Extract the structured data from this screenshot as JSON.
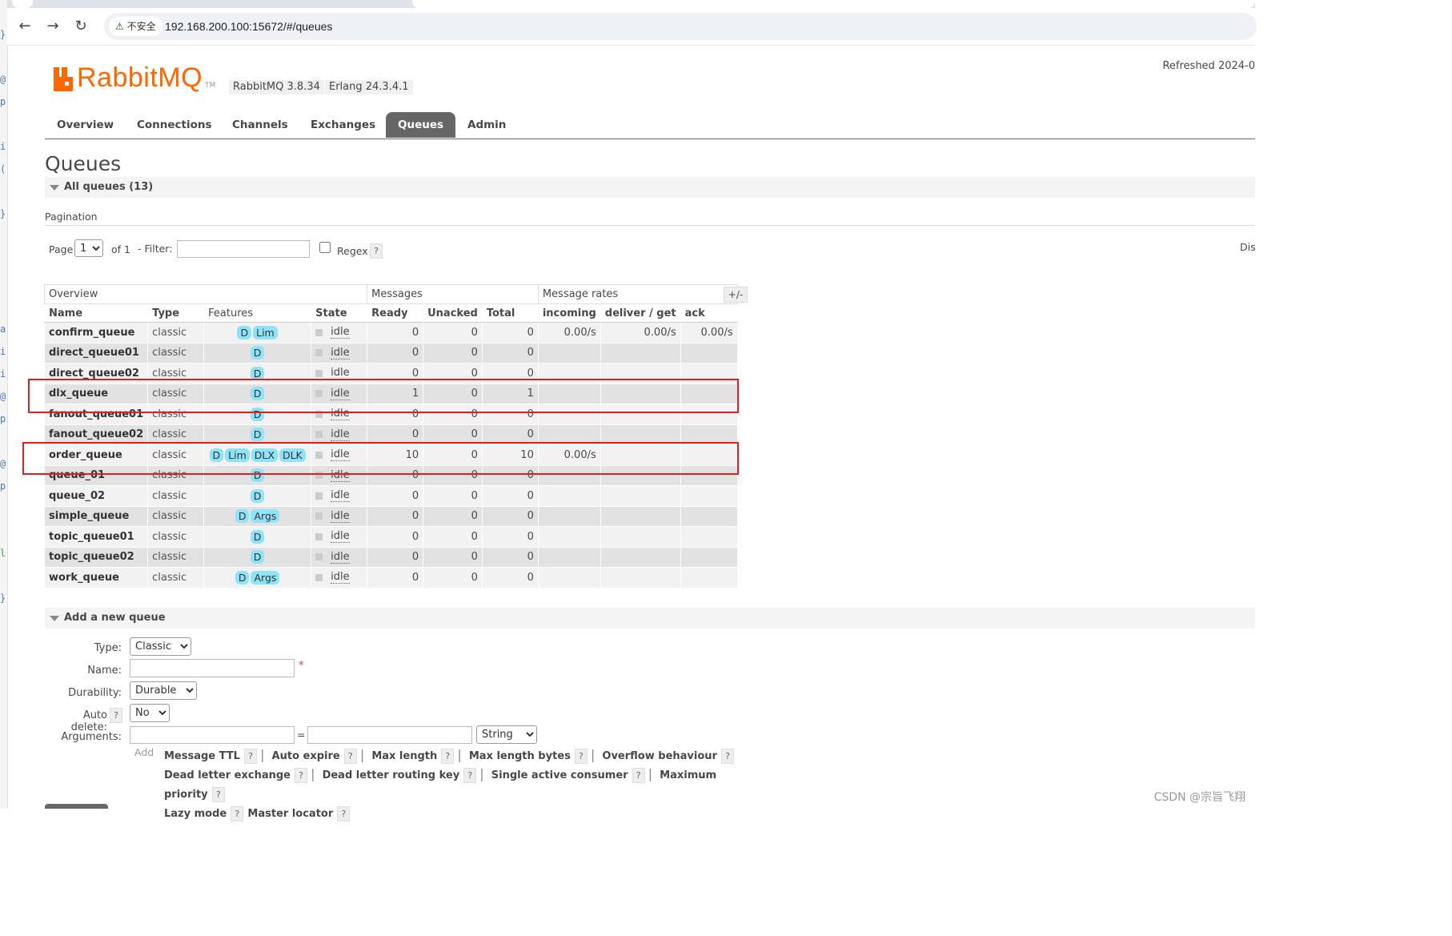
{
  "browser": {
    "security_label": "不安全",
    "url": "192.168.200.100:15672/#/queues"
  },
  "header": {
    "brand": "RabbitMQ",
    "tm": "TM",
    "rabbitmq_version": "RabbitMQ 3.8.34",
    "erlang_version": "Erlang 24.3.4.1",
    "refreshed": "Refreshed 2024-0"
  },
  "nav": {
    "tabs": [
      {
        "label": "Overview"
      },
      {
        "label": "Connections"
      },
      {
        "label": "Channels"
      },
      {
        "label": "Exchanges"
      },
      {
        "label": "Queues",
        "active": true
      },
      {
        "label": "Admin"
      }
    ]
  },
  "page": {
    "title": "Queues",
    "all_queues_label": "All queues (13)"
  },
  "pagination": {
    "section_label": "Pagination",
    "page_label": "Page",
    "page_value": "1",
    "of_label": "of 1",
    "filter_label": "- Filter:",
    "filter_value": "",
    "regex_label": "Regex",
    "help": "?",
    "display_cut": "Dis"
  },
  "table": {
    "group_headers": [
      "Overview",
      "Messages",
      "Message rates"
    ],
    "plus_minus": "+/-",
    "columns": [
      "Name",
      "Type",
      "Features",
      "State",
      "Ready",
      "Unacked",
      "Total",
      "incoming",
      "deliver / get",
      "ack"
    ],
    "rows": [
      {
        "name": "confirm_queue",
        "type": "classic",
        "features": [
          "D",
          "Lim"
        ],
        "state": "idle",
        "ready": "0",
        "unacked": "0",
        "total": "0",
        "incoming": "0.00/s",
        "deliver": "0.00/s",
        "ack": "0.00/s"
      },
      {
        "name": "direct_queue01",
        "type": "classic",
        "features": [
          "D"
        ],
        "state": "idle",
        "ready": "0",
        "unacked": "0",
        "total": "0",
        "incoming": "",
        "deliver": "",
        "ack": ""
      },
      {
        "name": "direct_queue02",
        "type": "classic",
        "features": [
          "D"
        ],
        "state": "idle",
        "ready": "0",
        "unacked": "0",
        "total": "0",
        "incoming": "",
        "deliver": "",
        "ack": ""
      },
      {
        "name": "dlx_queue",
        "type": "classic",
        "features": [
          "D"
        ],
        "state": "idle",
        "ready": "1",
        "unacked": "0",
        "total": "1",
        "incoming": "",
        "deliver": "",
        "ack": ""
      },
      {
        "name": "fanout_queue01",
        "type": "classic",
        "features": [
          "D"
        ],
        "state": "idle",
        "ready": "0",
        "unacked": "0",
        "total": "0",
        "incoming": "",
        "deliver": "",
        "ack": ""
      },
      {
        "name": "fanout_queue02",
        "type": "classic",
        "features": [
          "D"
        ],
        "state": "idle",
        "ready": "0",
        "unacked": "0",
        "total": "0",
        "incoming": "",
        "deliver": "",
        "ack": ""
      },
      {
        "name": "order_queue",
        "type": "classic",
        "features": [
          "D",
          "Lim",
          "DLX",
          "DLK"
        ],
        "state": "idle",
        "ready": "10",
        "unacked": "0",
        "total": "10",
        "incoming": "0.00/s",
        "deliver": "",
        "ack": ""
      },
      {
        "name": "queue_01",
        "type": "classic",
        "features": [
          "D"
        ],
        "state": "idle",
        "ready": "0",
        "unacked": "0",
        "total": "0",
        "incoming": "",
        "deliver": "",
        "ack": ""
      },
      {
        "name": "queue_02",
        "type": "classic",
        "features": [
          "D"
        ],
        "state": "idle",
        "ready": "0",
        "unacked": "0",
        "total": "0",
        "incoming": "",
        "deliver": "",
        "ack": ""
      },
      {
        "name": "simple_queue",
        "type": "classic",
        "features": [
          "D",
          "Args"
        ],
        "state": "idle",
        "ready": "0",
        "unacked": "0",
        "total": "0",
        "incoming": "",
        "deliver": "",
        "ack": ""
      },
      {
        "name": "topic_queue01",
        "type": "classic",
        "features": [
          "D"
        ],
        "state": "idle",
        "ready": "0",
        "unacked": "0",
        "total": "0",
        "incoming": "",
        "deliver": "",
        "ack": ""
      },
      {
        "name": "topic_queue02",
        "type": "classic",
        "features": [
          "D"
        ],
        "state": "idle",
        "ready": "0",
        "unacked": "0",
        "total": "0",
        "incoming": "",
        "deliver": "",
        "ack": ""
      },
      {
        "name": "work_queue",
        "type": "classic",
        "features": [
          "D",
          "Args"
        ],
        "state": "idle",
        "ready": "0",
        "unacked": "0",
        "total": "0",
        "incoming": "",
        "deliver": "",
        "ack": ""
      }
    ]
  },
  "add_queue": {
    "section_label": "Add a new queue",
    "type_label": "Type:",
    "type_value": "Classic",
    "name_label": "Name:",
    "name_value": "",
    "required_mark": "*",
    "durability_label": "Durability:",
    "durability_value": "Durable",
    "auto_delete_label": "Auto delete:",
    "auto_delete_value": "No",
    "arguments_label": "Arguments:",
    "equals": "=",
    "arg_type_value": "String",
    "add_label": "Add",
    "arg_keys": [
      "Message TTL",
      "Auto expire",
      "Max length",
      "Max length bytes",
      "Overflow behaviour",
      "Dead letter exchange",
      "Dead letter routing key",
      "Single active consumer",
      "Maximum priority",
      "Lazy mode",
      "Master locator"
    ],
    "pipe": "|"
  },
  "watermark": "CSDN @宗旨飞翔",
  "gutter_glyphs": [
    "}",
    "@",
    "p",
    "i",
    "(",
    "}",
    "a",
    "i",
    "i",
    "@",
    "p",
    "@",
    "p",
    "l",
    "}"
  ]
}
